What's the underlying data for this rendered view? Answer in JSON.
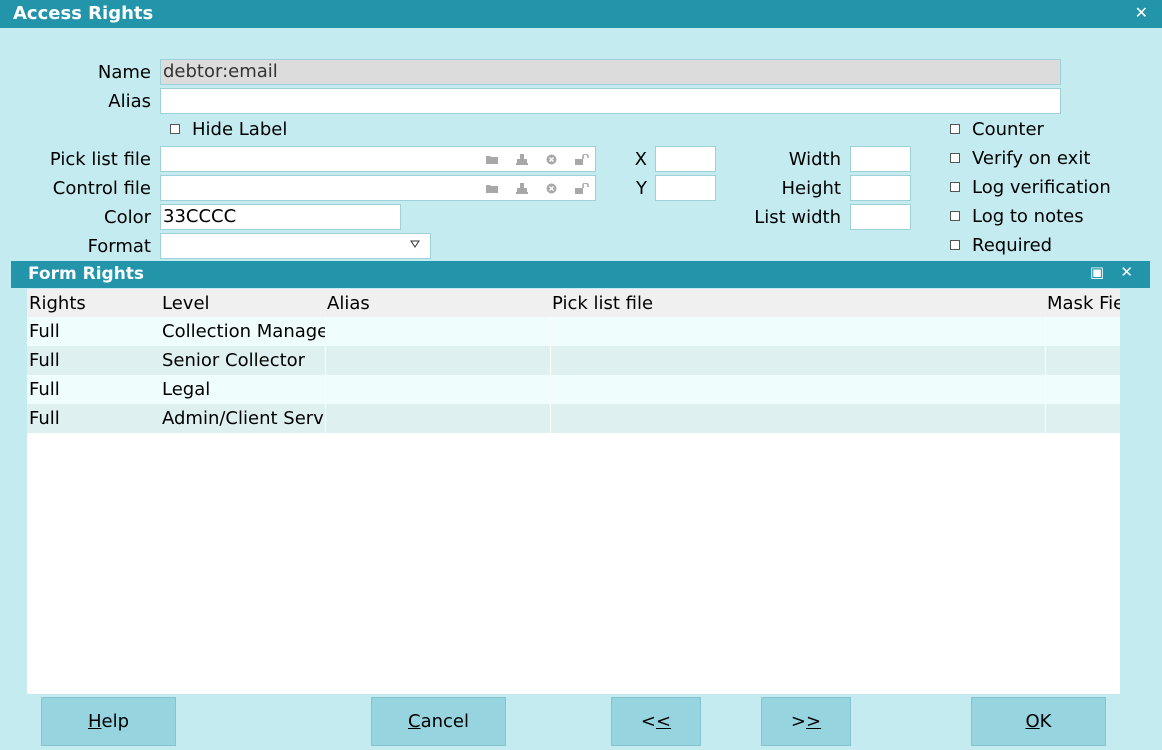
{
  "window": {
    "title": "Access Rights",
    "close_glyph": "✕"
  },
  "form": {
    "name_label": "Name",
    "name_value": "debtor:email",
    "alias_label": "Alias",
    "alias_value": "",
    "hide_label": "Hide Label",
    "picklist_label": "Pick list file",
    "picklist_value": "",
    "control_label": "Control file",
    "control_value": "",
    "color_label": "Color",
    "color_value": "33CCCC",
    "format_label": "Format",
    "format_value": "",
    "x_label": "X",
    "x_value": "",
    "y_label": "Y",
    "y_value": "",
    "width_label": "Width",
    "width_value": "",
    "height_label": "Height",
    "height_value": "",
    "listwidth_label": "List width",
    "listwidth_value": "",
    "checkboxes": {
      "counter": "Counter",
      "verify": "Verify on exit",
      "logverify": "Log verification",
      "lognotes": "Log to notes",
      "required": "Required"
    },
    "file_icons": [
      "folder-icon",
      "stamp-icon",
      "clear-icon",
      "lock-icon"
    ]
  },
  "form_rights": {
    "title": "Form Rights",
    "maximize_glyph": "▣",
    "close_glyph": "✕",
    "columns": [
      "Rights",
      "Level",
      "Alias",
      "Pick list file",
      "Mask Fie"
    ],
    "rows": [
      {
        "rights": "Full",
        "level": "Collection Manager",
        "alias": "",
        "picklist": "",
        "mask": ""
      },
      {
        "rights": "Full",
        "level": "Senior Collector",
        "alias": "",
        "picklist": "",
        "mask": ""
      },
      {
        "rights": "Full",
        "level": "Legal",
        "alias": "",
        "picklist": "",
        "mask": ""
      },
      {
        "rights": "Full",
        "level": "Admin/Client Service",
        "alias": "",
        "picklist": "",
        "mask": ""
      }
    ]
  },
  "buttons": {
    "help": {
      "accel": "H",
      "rest": "elp"
    },
    "cancel": {
      "accel": "C",
      "rest": "ancel"
    },
    "prev": {
      "pre": "<",
      "accel": "<"
    },
    "next": {
      "pre": ">",
      "accel": ">"
    },
    "ok": {
      "accel": "O",
      "rest": "K"
    }
  },
  "colors": {
    "accent": "#2395aa",
    "background": "#c3ebf0",
    "button": "#96d4df"
  }
}
